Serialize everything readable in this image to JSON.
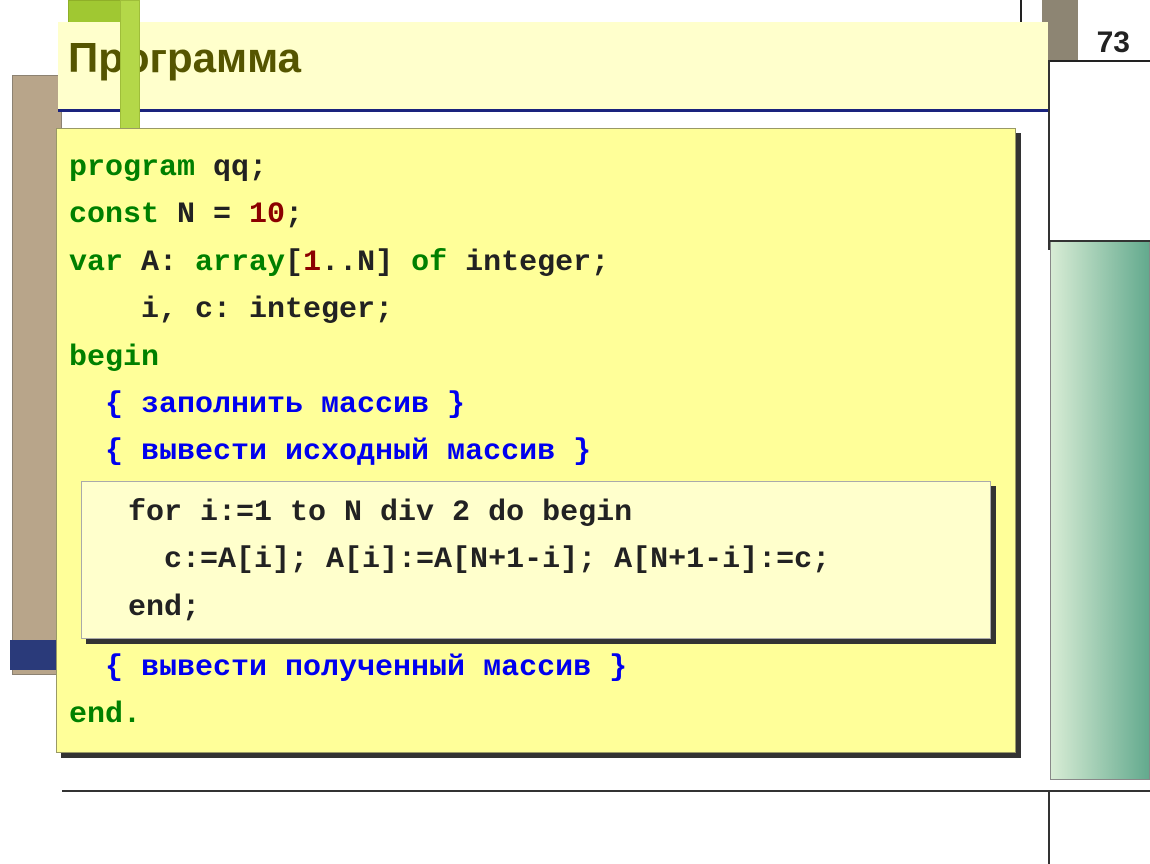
{
  "page_number": "73",
  "title": "Программа",
  "code": {
    "l1a": "program",
    "l1b": " qq;",
    "l2a": "const",
    "l2b": " N = ",
    "l2c": "10",
    "l2d": ";",
    "l3a": "var",
    "l3b": " A: ",
    "l3c": "array",
    "l3d": "[",
    "l3e": "1",
    "l3f": "..N] ",
    "l3g": "of",
    "l3h": " integer;",
    "l4": "    i, c: integer;",
    "l5": "begin",
    "c1": "  { заполнить массив }",
    "c2": "  { вывести исходный массив }",
    "inner1": "  for i:=1 to N div 2 do begin",
    "inner2": "    c:=A[i]; A[i]:=A[N+1-i]; A[N+1-i]:=c;",
    "inner3": "  end;",
    "c3": "  { вывести полученный массив }",
    "l6": "end."
  }
}
